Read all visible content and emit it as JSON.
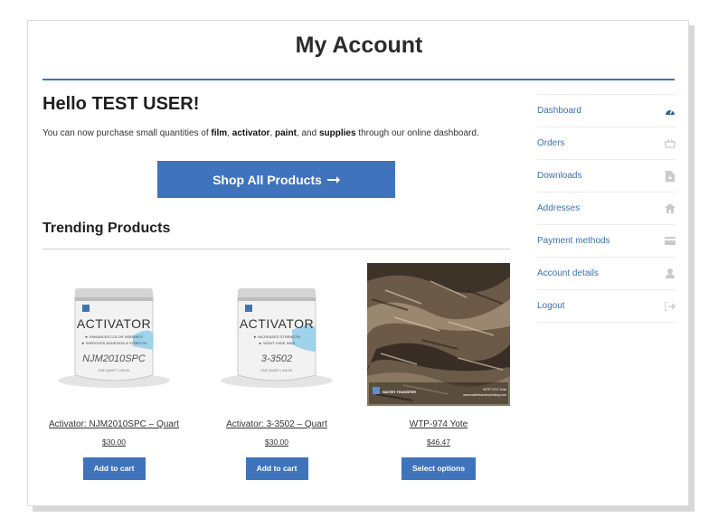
{
  "page": {
    "title": "My Account"
  },
  "greeting": {
    "hello": "Hello TEST USER!",
    "intro_prefix": "You can now purchase small quantities of ",
    "w1": "film",
    "s1": ", ",
    "w2": "activator",
    "s2": ", ",
    "w3": "paint",
    "s3": ", and ",
    "w4": "supplies",
    "intro_suffix": " through our online dashboard."
  },
  "shop_button": {
    "label": "Shop All Products",
    "icon": "arrow-right-icon"
  },
  "trending": {
    "heading": "Trending Products",
    "products": [
      {
        "name": "Activator: NJM2010SPC – Quart",
        "price": "$30.00",
        "button": "Add to cart",
        "can_brand": "ACTIVATOR",
        "can_line1": "► ENHANCES COLOR VIBRANCY",
        "can_line2": "► IMPROVES ADHESION & STRETCH",
        "can_code": "NJM2010SPC",
        "can_size": "ONE QUART | 946 ML"
      },
      {
        "name": "Activator: 3-3502 – Quart",
        "price": "$30.00",
        "button": "Add to cart",
        "can_brand": "ACTIVATOR",
        "can_line1": "► INCREASED STRENGTH",
        "can_line2": "► WON'T FADE INKS",
        "can_code": "3-3502",
        "can_size": "ONE QUART | 946 ML"
      },
      {
        "name": "WTP-974 Yote",
        "price": "$46.47",
        "button": "Select options",
        "logo_text": "WATER TRANSFER",
        "tag": "WTP-974 Yote",
        "site": "www.watertransferprinting.com"
      }
    ]
  },
  "nav": {
    "items": [
      {
        "label": "Dashboard",
        "icon": "dashboard-gauge-icon"
      },
      {
        "label": "Orders",
        "icon": "basket-icon"
      },
      {
        "label": "Downloads",
        "icon": "file-download-icon"
      },
      {
        "label": "Addresses",
        "icon": "home-icon"
      },
      {
        "label": "Payment methods",
        "icon": "credit-card-icon"
      },
      {
        "label": "Account details",
        "icon": "user-icon"
      },
      {
        "label": "Logout",
        "icon": "logout-icon"
      }
    ]
  },
  "colors": {
    "accent": "#3f74bd",
    "link": "#3d6fb0",
    "icon_muted": "#c9c9c9",
    "icon_active": "#2f5e99"
  }
}
